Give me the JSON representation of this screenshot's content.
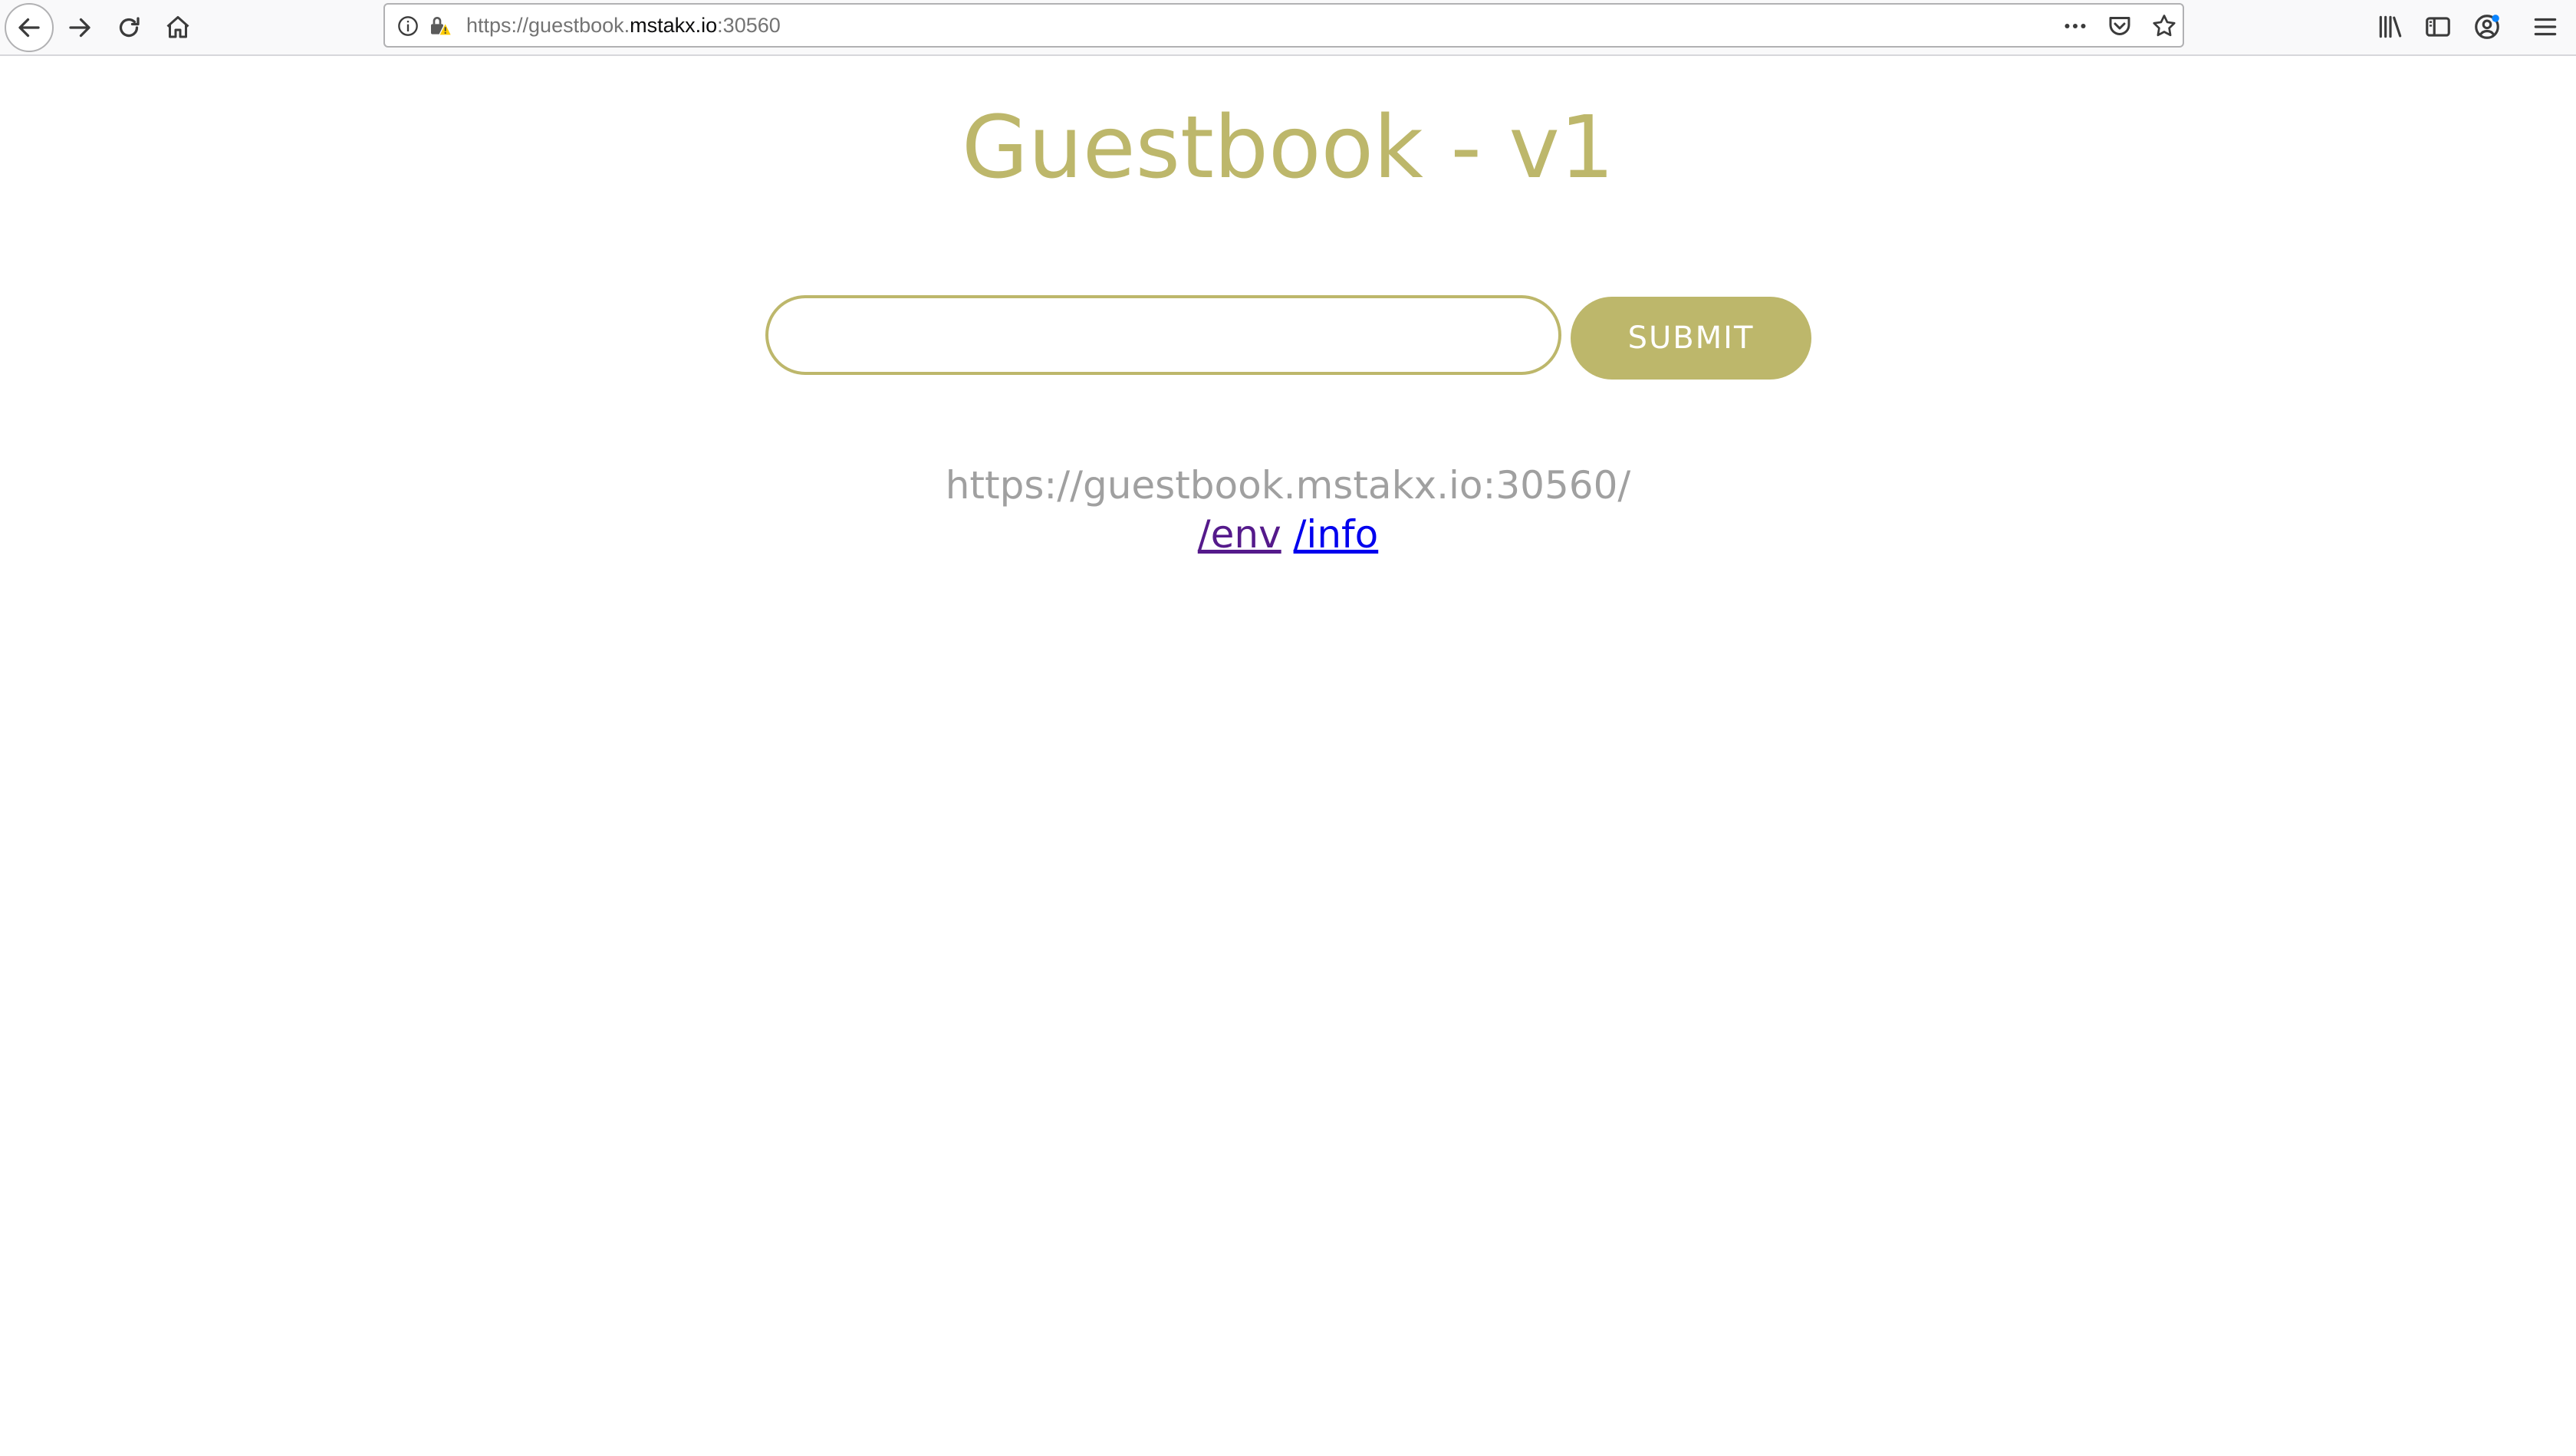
{
  "browser": {
    "url_prefix": "https://guestbook.",
    "url_domain": "mstakx.io",
    "url_suffix": ":30560",
    "icons": {
      "back": "arrow-left-icon",
      "forward": "arrow-right-icon",
      "reload": "reload-icon",
      "home": "home-icon",
      "info": "info-icon",
      "lock": "insecure-lock-icon",
      "more": "more-actions-icon",
      "pocket": "pocket-icon",
      "bookmark": "star-icon",
      "library": "library-icon",
      "sidebar": "sidebar-icon",
      "account": "account-icon",
      "menu": "hamburger-menu-icon"
    }
  },
  "page": {
    "title": "Guestbook - v1",
    "entry": {
      "value": "",
      "placeholder": ""
    },
    "submit_label": "SUBMIT",
    "address": "https://guestbook.mstakx.io:30560/",
    "links": {
      "env": "/env",
      "info": "/info"
    }
  },
  "colors": {
    "accent": "#bdb76b",
    "address_text": "#a0a0a0",
    "visited_link": "#551a8b",
    "link": "#0000ee"
  }
}
